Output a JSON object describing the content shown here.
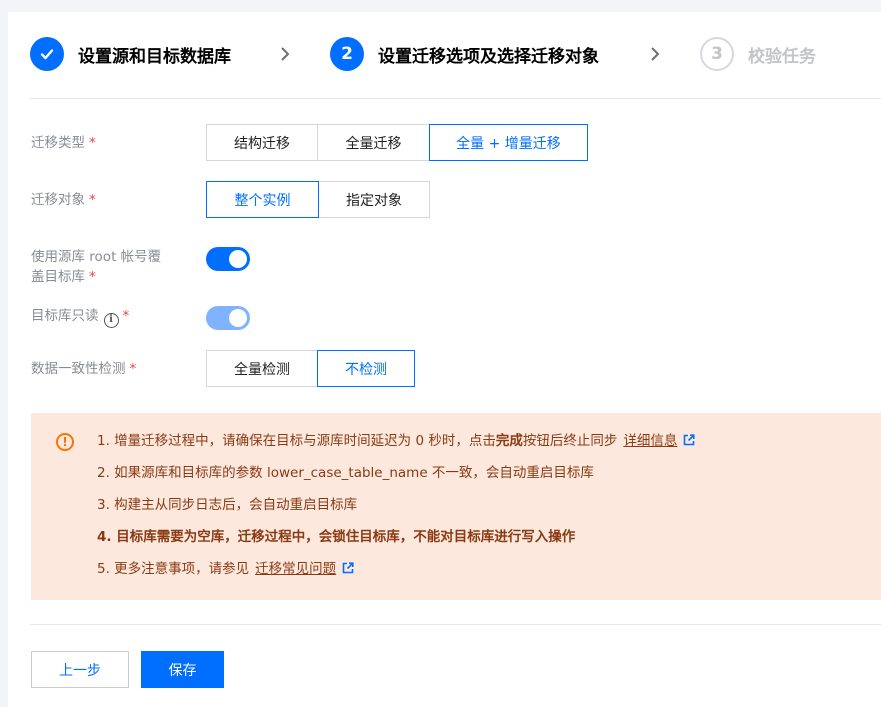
{
  "steps": [
    {
      "label": "设置源和目标数据库",
      "number": "✓",
      "state": "done"
    },
    {
      "label": "设置迁移选项及选择迁移对象",
      "number": "2",
      "state": "active"
    },
    {
      "label": "校验任务",
      "number": "3",
      "state": "todo"
    }
  ],
  "form": {
    "migration_type": {
      "label": "迁移类型",
      "required": "*",
      "options": [
        "结构迁移",
        "全量迁移",
        "全量 + 增量迁移"
      ],
      "selected": "全量 + 增量迁移"
    },
    "migration_object": {
      "label": "迁移对象",
      "required": "*",
      "options": [
        "整个实例",
        "指定对象"
      ],
      "selected": "整个实例"
    },
    "root_override": {
      "label_line1": "使用源库 root 帐号覆",
      "label_line2": "盖目标库",
      "required": "*",
      "on": true
    },
    "target_readonly": {
      "label": "目标库只读",
      "info_icon": "i",
      "required": "*",
      "on": true,
      "disabled": true
    },
    "consistency_check": {
      "label": "数据一致性检测",
      "required": "*",
      "options": [
        "全量检测",
        "不检测"
      ],
      "selected": "不检测"
    }
  },
  "notice": {
    "icon": "!",
    "item1_prefix": "1. 增量迁移过程中，请确保在目标与源库时间延迟为 0 秒时，点击",
    "item1_bold": "完成",
    "item1_suffix": "按钮后终止同步",
    "item1_link": "详细信息",
    "item2": "2. 如果源库和目标库的参数 lower_case_table_name 不一致，会自动重启目标库",
    "item3": "3. 构建主从同步日志后，会自动重启目标库",
    "item4": "4. 目标库需要为空库，迁移过程中，会锁住目标库，不能对目标库进行写入操作",
    "item5_prefix": "5. 更多注意事项，请参见",
    "item5_link": "迁移常见问题"
  },
  "footer": {
    "prev_label": "上一步",
    "save_label": "保存"
  },
  "colors": {
    "primary": "#006eff",
    "notice_bg": "#fde8dd",
    "notice_text": "#8a3a12",
    "warning": "#ff7200",
    "required": "#e54545"
  }
}
